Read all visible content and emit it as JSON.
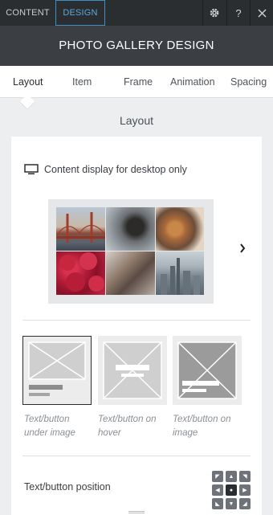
{
  "topbar": {
    "tabs": [
      {
        "label": "CONTENT"
      },
      {
        "label": "DESIGN"
      }
    ],
    "help_label": "?",
    "gear_icon": "gear-icon",
    "close_icon": "close-icon"
  },
  "title": "PHOTO GALLERY DESIGN",
  "subtabs": [
    {
      "label": "Layout"
    },
    {
      "label": "Item"
    },
    {
      "label": "Frame"
    },
    {
      "label": "Animation"
    },
    {
      "label": "Spacing"
    }
  ],
  "section_title": "Layout",
  "desktop_note": "Content display for desktop only",
  "preview": {
    "photos": [
      "golden-gate-bridge",
      "coffee-mug",
      "food-plate",
      "raspberries",
      "hand-phone",
      "city-skyline"
    ],
    "next_icon": "chevron-right-icon"
  },
  "options": [
    {
      "label_line1": "Text/button",
      "label_line2": "under image",
      "selected": true
    },
    {
      "label_line1": "Text/button on",
      "label_line2": "hover",
      "selected": false
    },
    {
      "label_line1": "Text/button on",
      "label_line2": "image",
      "selected": false
    }
  ],
  "position_label": "Text/button position",
  "accent_color": "#3d8fc6"
}
